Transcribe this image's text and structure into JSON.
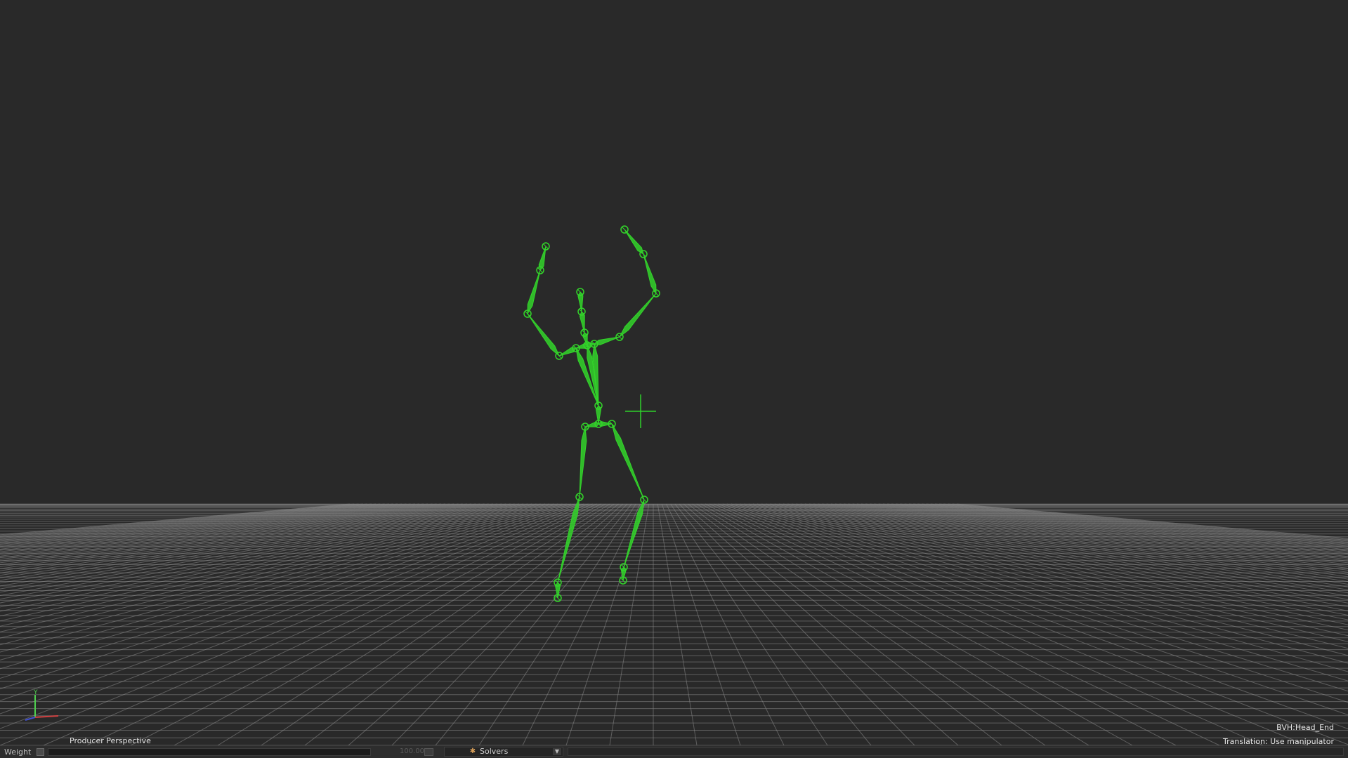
{
  "viewport": {
    "camera_label": "Producer Perspective",
    "selected_object": "BVH:Head_End",
    "tool_status": "Translation: Use manipulator",
    "axis_label_y": "Y",
    "colors": {
      "background": "#292929",
      "skeleton": "#33d42a",
      "grid": "#8a8a8a"
    }
  },
  "bottom_bar": {
    "weight_label": "Weight",
    "weight_value": "100.00",
    "solver_dropdown_label": "Solvers",
    "solver_icon": "solver-icon"
  }
}
